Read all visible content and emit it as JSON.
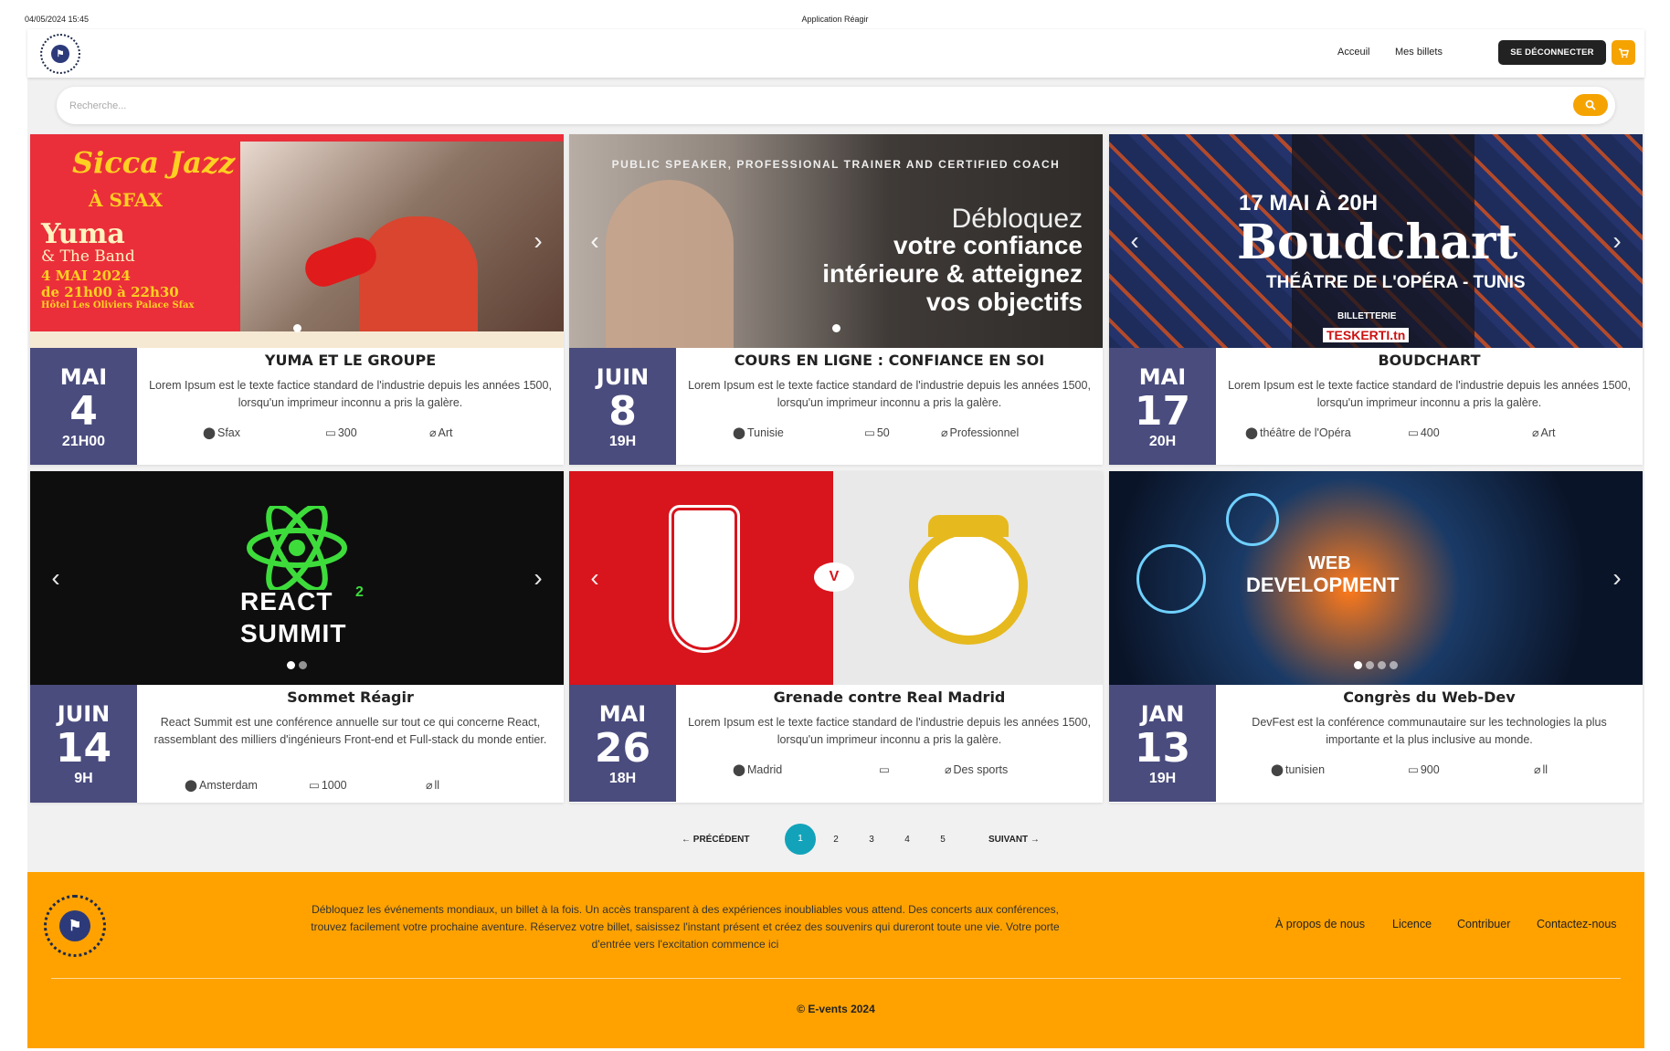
{
  "print_header": {
    "date": "04/05/2024 15:45",
    "app_title": "Application Réagir"
  },
  "nav": {
    "links": [
      "Acceuil",
      "Mes billets"
    ],
    "logout_label": "SE DÉCONNECTER"
  },
  "search": {
    "placeholder": "Recherche..."
  },
  "events": [
    {
      "month": "MAI",
      "day": "4",
      "time": "21H00",
      "title": "YUMA ET LE GROUPE",
      "description": "Lorem Ipsum est le texte factice standard de l'industrie depuis les années 1500, lorsqu'un imprimeur inconnu a pris la galère.",
      "location": "Sfax",
      "seats": "300",
      "category": "Art",
      "image_texts": [
        "Sicca Jazz",
        "À SFAX",
        "Yuma",
        "& The Band",
        "4 MAI 2024",
        "de 21h00 à 22h30",
        "Hôtel Les Oliviers Palace Sfax"
      ],
      "slides": 1,
      "active_slide": 0
    },
    {
      "month": "JUIN",
      "day": "8",
      "time": "19H",
      "title": "COURS EN LIGNE : CONFIANCE EN SOI",
      "description": "Lorem Ipsum est le texte factice standard de l'industrie depuis les années 1500, lorsqu'un imprimeur inconnu a pris la galère.",
      "location": "Tunisie",
      "seats": "50",
      "category": "Professionnel",
      "image_texts": [
        "PUBLIC SPEAKER, PROFESSIONAL TRAINER AND CERTIFIED COACH",
        "Débloquez",
        "votre confiance",
        "intérieure & atteignez",
        "vos objectifs"
      ],
      "slides": 1,
      "active_slide": 0
    },
    {
      "month": "MAI",
      "day": "17",
      "time": "20H",
      "title": "BOUDCHART",
      "description": "Lorem Ipsum est le texte factice standard de l'industrie depuis les années 1500, lorsqu'un imprimeur inconnu a pris la galère.",
      "location": "théâtre de l'Opéra",
      "seats": "400",
      "category": "Art",
      "image_texts": [
        "17 MAI À 20H",
        "Boudchart",
        "THÉÂTRE DE L'OPÉRA - TUNIS",
        "BILLETTERIE",
        "TESKERTI.tn"
      ],
      "slides": 1,
      "active_slide": 0
    },
    {
      "month": "JUIN",
      "day": "14",
      "time": "9H",
      "title": "Sommet Réagir",
      "description": "React Summit est une conférence annuelle sur tout ce qui concerne React, rassemblant des milliers d'ingénieurs Front-end et Full-stack du monde entier.",
      "location": "Amsterdam",
      "seats": "1000",
      "category": "ll",
      "image_texts": [
        "REACT",
        "2",
        "SUMMIT"
      ],
      "slides": 2,
      "active_slide": 0
    },
    {
      "month": "MAI",
      "day": "26",
      "time": "18H",
      "title": "Grenade contre Real Madrid",
      "description": "Lorem Ipsum est le texte factice standard de l'industrie depuis les années 1500, lorsqu'un imprimeur inconnu a pris la galère.",
      "location": "Madrid",
      "seats": "",
      "category": "Des sports",
      "image_texts": [
        "V"
      ],
      "slides": 0,
      "active_slide": 0
    },
    {
      "month": "JAN",
      "day": "13",
      "time": "19H",
      "title": "Congrès du Web-Dev",
      "description": "DevFest est la conférence communautaire sur les technologies la plus importante et la plus inclusive au monde.",
      "location": "tunisien",
      "seats": "900",
      "category": "ll",
      "image_texts": [
        "WEB",
        "DEVELOPMENT"
      ],
      "slides": 4,
      "active_slide": 0
    }
  ],
  "pagination": {
    "prev": "PRÉCÉDENT",
    "next": "SUIVANT",
    "pages": [
      "1",
      "2",
      "3",
      "4",
      "5"
    ],
    "active": "1"
  },
  "footer": {
    "text": "Débloquez les événements mondiaux, un billet à la fois. Un accès transparent à des expériences inoubliables vous attend. Des concerts aux conférences, trouvez facilement votre prochaine aventure. Réservez votre billet, saisissez l'instant présent et créez des souvenirs qui dureront toute une vie. Votre porte d'entrée vers l'excitation commence ici",
    "links": [
      "À propos de nous",
      "Licence",
      "Contribuer",
      "Contactez-nous"
    ],
    "copyright": "© E-vents 2024"
  },
  "colors": {
    "accent": "#ffa200",
    "date_box": "#4a4c7e",
    "pagination_active": "#12a3ba",
    "dark_button": "#222222"
  }
}
